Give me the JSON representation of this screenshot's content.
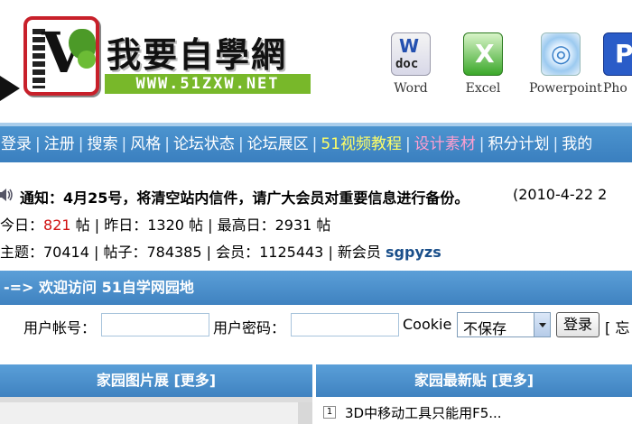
{
  "header": {
    "site_title": "我要自學網",
    "site_url": "WWW.51ZXW.NET",
    "apps": [
      {
        "label": "Word",
        "icon": "word-doc-icon"
      },
      {
        "label": "Excel",
        "icon": "excel-icon"
      },
      {
        "label": "Powerpoint",
        "icon": "powerpoint-icon"
      },
      {
        "label": "Pho",
        "icon": "photoshop-icon"
      }
    ]
  },
  "nav": {
    "items": [
      "登录",
      "注册",
      "搜索",
      "风格",
      "论坛状态",
      "论坛展区",
      "51视频教程",
      "设计素材",
      "积分计划",
      "我的"
    ],
    "separator": "|"
  },
  "notice": {
    "text": "通知：4月25号，将清空站内信件，请广大会员对重要信息进行备份。",
    "date": "(2010-4-22 2"
  },
  "stats": {
    "today_label": "今日：",
    "today_value": "821",
    "today_unit": " 帖 | 昨日：1320 帖 | 最高日：2931 帖",
    "line2_prefix": "主题：70414 | 帖子：784385 | 会员：1125443 | 新会员 ",
    "new_member": "sgpyzs"
  },
  "welcome": {
    "text": "-=> 欢迎访问 51自学网园地"
  },
  "login": {
    "account_label": "用户帐号：",
    "password_label": "用户密码：",
    "cookie_label": "Cookie",
    "cookie_value": "不保存",
    "login_button": "登录",
    "trailing": "[ 忘"
  },
  "panels": {
    "left_title": "家园图片展 [更多]",
    "right_title": "家园最新贴 [更多]",
    "latest_posts": [
      {
        "index": "1",
        "title": "3D中移动工具只能用F5..."
      }
    ]
  },
  "colors": {
    "nav_bg": "#3f86c5",
    "highlight_yellow": "#ffff66",
    "highlight_pink": "#ff9fd0",
    "stat_red": "#d01010",
    "member_blue": "#1a4f8a",
    "logo_green": "#78b82a"
  }
}
